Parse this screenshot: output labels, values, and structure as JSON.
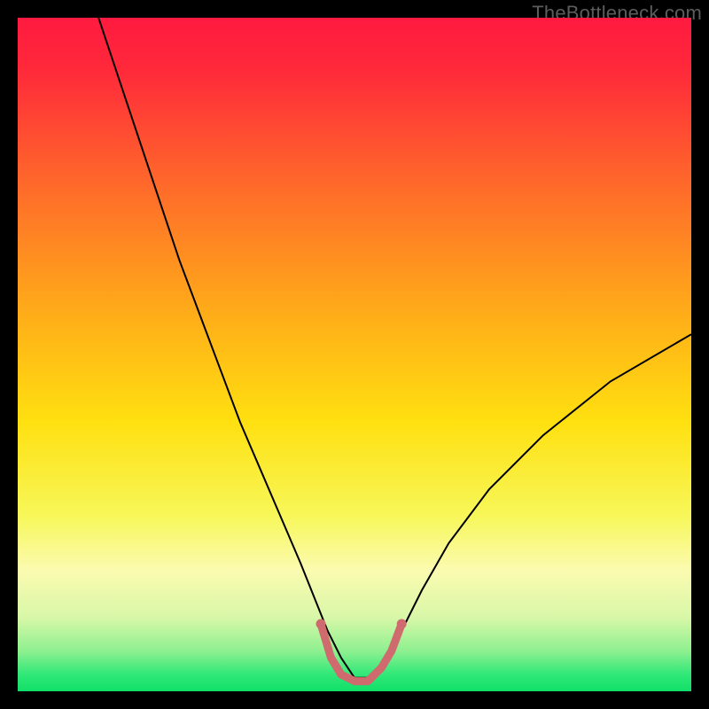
{
  "watermark": "TheBottleneck.com",
  "chart_data": {
    "type": "line",
    "title": "",
    "xlabel": "",
    "ylabel": "",
    "xlim": [
      0,
      100
    ],
    "ylim": [
      0,
      100
    ],
    "grid": false,
    "legend": false,
    "background_gradient_stops": [
      {
        "offset": 0.0,
        "color": "#ff1a3f"
      },
      {
        "offset": 0.08,
        "color": "#ff2a3a"
      },
      {
        "offset": 0.25,
        "color": "#ff6a2a"
      },
      {
        "offset": 0.45,
        "color": "#ffb018"
      },
      {
        "offset": 0.6,
        "color": "#ffe010"
      },
      {
        "offset": 0.74,
        "color": "#f7f75a"
      },
      {
        "offset": 0.82,
        "color": "#fbfbb0"
      },
      {
        "offset": 0.89,
        "color": "#d9f7a8"
      },
      {
        "offset": 0.94,
        "color": "#8ef090"
      },
      {
        "offset": 0.975,
        "color": "#30e878"
      },
      {
        "offset": 1.0,
        "color": "#10df68"
      }
    ],
    "series": [
      {
        "name": "bottleneck-curve",
        "color": "#000000",
        "stroke_width": 2,
        "x": [
          12,
          15,
          18,
          21,
          24,
          27,
          30,
          33,
          36,
          39,
          42,
          44,
          46,
          48,
          50,
          52,
          54,
          57,
          60,
          64,
          70,
          78,
          88,
          100
        ],
        "y": [
          100,
          91,
          82,
          73,
          64,
          56,
          48,
          40,
          33,
          26,
          19,
          14,
          9,
          5,
          2,
          2,
          4,
          9,
          15,
          22,
          30,
          38,
          46,
          53
        ]
      },
      {
        "name": "optimal-range-marker",
        "color": "#cf6a6e",
        "stroke_width": 9,
        "linecap": "round",
        "x": [
          45,
          46.5,
          48,
          50,
          52,
          54,
          55.5,
          57
        ],
        "y": [
          10,
          5,
          2.5,
          1.5,
          1.5,
          3.5,
          6,
          10
        ]
      }
    ],
    "markers": [
      {
        "name": "left-endpoint-dot",
        "x": 45,
        "y": 10,
        "r": 5.5,
        "color": "#cf6a6e"
      },
      {
        "name": "right-endpoint-dot",
        "x": 57,
        "y": 10,
        "r": 5.5,
        "color": "#cf6a6e"
      }
    ]
  }
}
